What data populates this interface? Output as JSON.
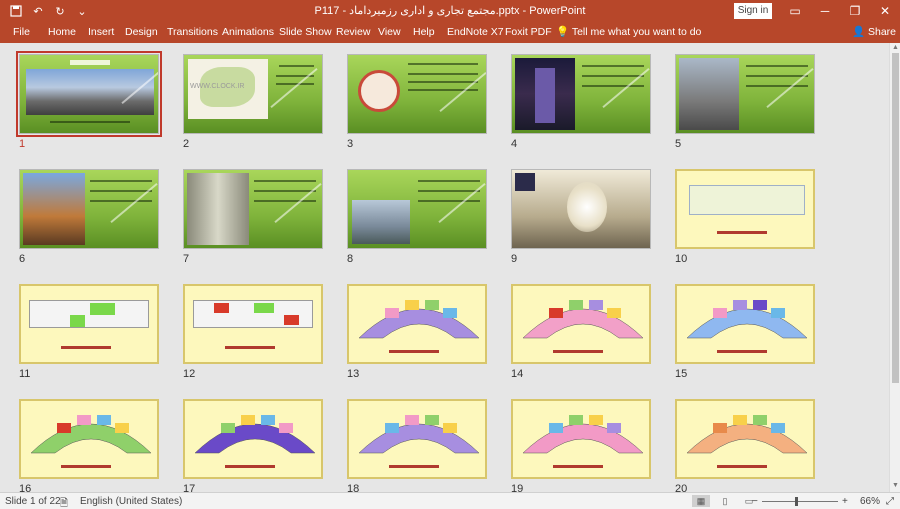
{
  "app": {
    "title": "P117 - مجتمع تجاری و اداری رزمیرداماد.pptx  -  PowerPoint",
    "signin_label": "Sign in",
    "titlebar_icons": [
      "save-icon",
      "undo-icon",
      "redo-icon",
      "customize-icon"
    ]
  },
  "ribbon": {
    "tabs": [
      "File",
      "Home",
      "Insert",
      "Design",
      "Transitions",
      "Animations",
      "Slide Show",
      "Review",
      "View",
      "Help",
      "EndNote X7",
      "Foxit PDF"
    ],
    "tell_me": "Tell me what you want to do",
    "share": "Share"
  },
  "slides": [
    {
      "num": "1"
    },
    {
      "num": "2"
    },
    {
      "num": "3"
    },
    {
      "num": "4"
    },
    {
      "num": "5"
    },
    {
      "num": "6"
    },
    {
      "num": "7"
    },
    {
      "num": "8"
    },
    {
      "num": "9"
    },
    {
      "num": "10"
    },
    {
      "num": "11"
    },
    {
      "num": "12"
    },
    {
      "num": "13"
    },
    {
      "num": "14"
    },
    {
      "num": "15"
    },
    {
      "num": "16"
    },
    {
      "num": "17"
    },
    {
      "num": "18"
    },
    {
      "num": "19"
    },
    {
      "num": "20"
    }
  ],
  "slide2_watermark": "WWW.CLOCK.IR",
  "status": {
    "slide_info": "Slide 1 of 22",
    "language": "English (United States)",
    "zoom_minus": "−",
    "zoom_plus": "+",
    "zoom": "66%"
  },
  "colors": {
    "accent": "#b7472a",
    "selected_outline": "#c0392b",
    "green_slide": "#7fb33b",
    "plan_background": "#fdf8bd"
  }
}
